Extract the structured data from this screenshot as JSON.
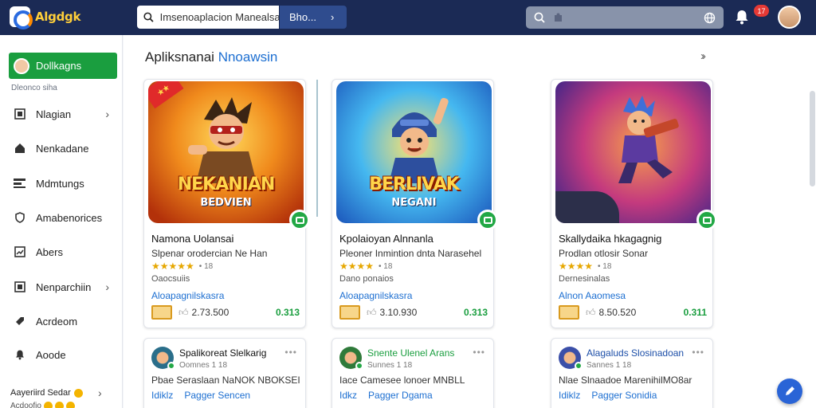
{
  "app": {
    "logo_text": "Algdgk"
  },
  "topbar": {
    "search_text": "Imsenoaplacion Manealsai",
    "search_button": "Bho...",
    "notification_count": "17"
  },
  "sidebar": {
    "active_label": "Dollkagns",
    "section_label": "Dleonco siha",
    "items": [
      {
        "label": "Nlagian",
        "icon": "grid-icon",
        "has_chevron": true
      },
      {
        "label": "Nenkadane",
        "icon": "home-icon",
        "has_chevron": false
      },
      {
        "label": "Mdmtungs",
        "icon": "list-icon",
        "has_chevron": false
      },
      {
        "label": "Amabenorices",
        "icon": "shield-icon",
        "has_chevron": false
      },
      {
        "label": "Abers",
        "icon": "chart-icon",
        "has_chevron": false
      },
      {
        "label": "Nenparchiin",
        "icon": "doc-icon",
        "has_chevron": true
      },
      {
        "label": "Acrdeom",
        "icon": "tag-icon",
        "has_chevron": false
      },
      {
        "label": "Aoode",
        "icon": "bell-icon",
        "has_chevron": false
      }
    ],
    "footer_label": "Aayeriird Sedar",
    "footer_sub": "Acdoofio"
  },
  "main": {
    "section_title_1": "Apliksnanai",
    "section_title_2": "Nnoawsin",
    "cards": [
      {
        "art_label": "NEKANIAN",
        "art_sub": "BEDVIEN",
        "title": "Namona Uolansai",
        "subtitle": "Slpenar orodercian Ne Han",
        "stars": "★★★★★",
        "rating": "• 18",
        "developer": "Oaocsuiis",
        "link": "Aloapagnilskasra",
        "downloads": "2.73.500",
        "price": "0.313",
        "colors": {
          "bg1": "#f6a823",
          "bg2": "#c43a0c"
        }
      },
      {
        "art_label": "BERLIVAK",
        "art_sub": "NEGANI",
        "title": "Kpolaioyan Alnnanla",
        "subtitle": "Pleoner Inmintion dnta Narasehel",
        "stars": "★★★★",
        "rating": "• 18",
        "developer": "Dano ponaios",
        "link": "Aloapagnilskasra",
        "downloads": "3.10.930",
        "price": "0.313",
        "colors": {
          "bg1": "#2a9fe0",
          "bg2": "#f39b2a"
        }
      },
      {
        "art_label": "",
        "art_sub": "",
        "title": "Skallydaika hkagagnig",
        "subtitle": "Prodlan otlosir Sonar",
        "stars": "★★★★",
        "rating": "• 18",
        "developer": "Dernesinalas",
        "link": "Alnon Aaomesa",
        "downloads": "8.50.520",
        "price": "0.311",
        "colors": {
          "bg1": "#6a3bd1",
          "bg2": "#e8532a"
        }
      }
    ],
    "mini_cards": [
      {
        "title": "Spalikoreat Slelkarig",
        "sub": "Oomnes 1 18",
        "desc": "Pbae Seraslaan NaNOK NBOKSEI",
        "link1": "Idiklz",
        "link2": "Pagger Sencen"
      },
      {
        "title": "Snente Ulenel Arans",
        "sub": "Sunnes 1 18",
        "desc": "Iace Camesee lonoer MNBLL",
        "link1": "Idkz",
        "link2": "Pagger Dgama"
      },
      {
        "title": "Alagaluds Slosinadoan",
        "sub": "Sannes 1 18",
        "desc": "Nlae Slnaadoe MarenihilMO8ar",
        "link1": "Idiklz",
        "link2": "Pagger Sonidia"
      }
    ]
  }
}
